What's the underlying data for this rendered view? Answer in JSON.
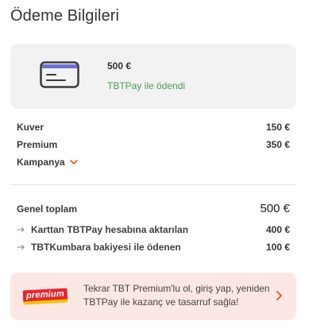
{
  "header": {
    "title": "Ödeme Bilgileri"
  },
  "payment": {
    "amount": "500 €",
    "status": "TBTPay ile ödendi",
    "icon": "credit-card-icon"
  },
  "breakdown": {
    "items": [
      {
        "label": "Kuver",
        "value": "150 €"
      },
      {
        "label": "Premium",
        "value": "350 €"
      }
    ],
    "campaign_label": "Kampanya"
  },
  "totals": {
    "label": "Genel toplam",
    "value": "500 €",
    "sub_items": [
      {
        "label": "Karttan TBTPay hesabına aktarılan",
        "value": "400 €"
      },
      {
        "label": "TBTKumbara bakiyesi ile ödenen",
        "value": "100 €"
      }
    ]
  },
  "promo": {
    "badge": "premium",
    "text": "Tekrar TBT Premium'lu ol, giriş yap, yeniden TBTPay ile kazanç ve tasarruf sağla!"
  },
  "colors": {
    "success": "#4c9a55",
    "accent": "#e8541e",
    "promo_bg": "#fde7e4",
    "badge_red": "#e8252c",
    "badge_yellow": "#f5c400"
  }
}
